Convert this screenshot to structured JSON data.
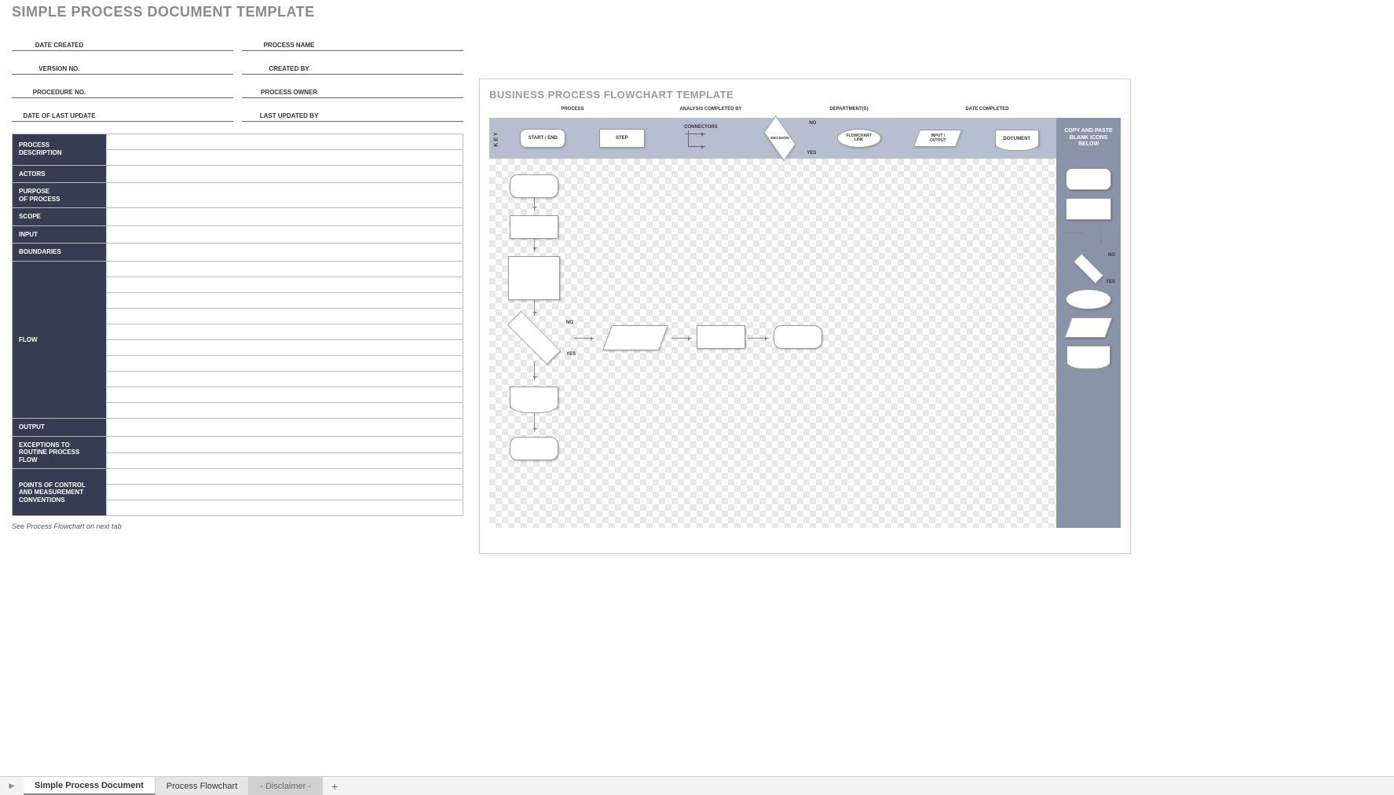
{
  "left": {
    "title": "SIMPLE PROCESS DOCUMENT TEMPLATE",
    "meta": [
      {
        "l": "DATE CREATED",
        "r": "PROCESS NAME"
      },
      {
        "l": "VERSION NO.",
        "r": "CREATED BY"
      },
      {
        "l": "PROCEDURE NO.",
        "r": "PROCESS OWNER"
      },
      {
        "l": "DATE OF LAST UPDATE",
        "r": "LAST UPDATED BY"
      }
    ],
    "sections": [
      {
        "label": "PROCESS\nDESCRIPTION",
        "rows": 2
      },
      {
        "label": "ACTORS",
        "rows": 1
      },
      {
        "label": "PURPOSE\nOF PROCESS",
        "rows": 1
      },
      {
        "label": "SCOPE",
        "rows": 1
      },
      {
        "label": "INPUT",
        "rows": 1
      },
      {
        "label": "BOUNDARIES",
        "rows": 1
      },
      {
        "label": "FLOW",
        "rows": 10
      },
      {
        "label": "OUTPUT",
        "rows": 1
      },
      {
        "label": "EXCEPTIONS TO\nROUTINE PROCESS FLOW",
        "rows": 2
      },
      {
        "label": "POINTS OF CONTROL\nAND MEASUREMENT\nCONVENTIONS",
        "rows": 3
      }
    ],
    "note": "See Process Flowchart on next tab"
  },
  "card": {
    "title": "BUSINESS PROCESS FLOWCHART TEMPLATE",
    "headers": [
      "PROCESS",
      "ANALYSIS COMPLETED BY",
      "DEPARTMENT(S)",
      "DATE COMPLETED"
    ],
    "key_label": "KEY",
    "key_shapes": {
      "terminator": "START / END",
      "step": "STEP",
      "connectors": "CONNECTORS",
      "decision": "DECISION",
      "decision_no": "NO",
      "decision_yes": "YES",
      "oval": "FLOWCHART\nLINK",
      "para": "INPUT /\nOUTPUT",
      "doc": "DOCUMENT"
    },
    "copy_label": "COPY AND PASTE\nBLANK ICONS\nBELOW",
    "flow_labels": {
      "no": "NO",
      "yes": "YES"
    },
    "palette_labels": {
      "no": "NO",
      "yes": "YES"
    }
  },
  "tabs": {
    "t1": "Simple Process Document",
    "t2": "Process Flowchart",
    "t3": "- Disclaimer -",
    "add": "+"
  }
}
